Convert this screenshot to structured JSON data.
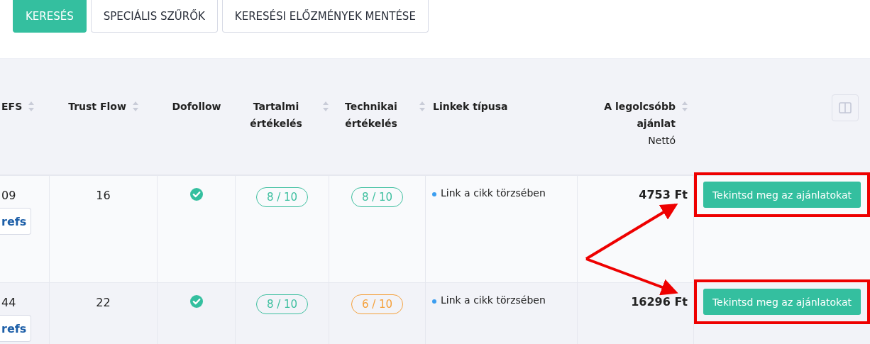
{
  "tabs": [
    {
      "label": "KERESÉS",
      "selected": true
    },
    {
      "label": "SPECIÁLIS SZŰRŐK",
      "selected": false
    },
    {
      "label": "KERESÉSI ELŐZMÉNYEK MENTÉSE",
      "selected": false
    }
  ],
  "table": {
    "columns": [
      {
        "label": "EFS",
        "sortable": true
      },
      {
        "label": "Trust Flow",
        "sortable": true
      },
      {
        "label": "Dofollow",
        "sortable": false
      },
      {
        "label": "Tartalmi értékelés",
        "sortable": true
      },
      {
        "label": "Technikai értékelés",
        "sortable": true
      },
      {
        "label": "Linkek típusa",
        "sortable": false
      },
      {
        "label": "A legolcsóbb ajánlat",
        "sublabel": "Nettó",
        "sortable": true
      }
    ],
    "rows": [
      {
        "column_1": "09",
        "ref_button": "refs",
        "trust_flow": "16",
        "dofollow": true,
        "content_score": {
          "text": "8 / 10",
          "color": "#3dbf9f"
        },
        "technical_score": {
          "text": "8 / 10",
          "color": "#3dbf9f"
        },
        "link_type": "Link a cikk törzsében",
        "price": "4753 Ft",
        "action": "Tekintsd meg az ajánlatokat",
        "highlighted": true
      },
      {
        "column_1": "44",
        "ref_button": "refs",
        "trust_flow": "22",
        "dofollow": true,
        "content_score": {
          "text": "8 / 10",
          "color": "#3dbf9f"
        },
        "technical_score": {
          "text": "6 / 10",
          "color": "#f5a03a"
        },
        "link_type": "Link a cikk törzsében",
        "price": "16296 Ft",
        "action": "Tekintsd meg az ajánlatokat",
        "highlighted": true
      }
    ]
  }
}
